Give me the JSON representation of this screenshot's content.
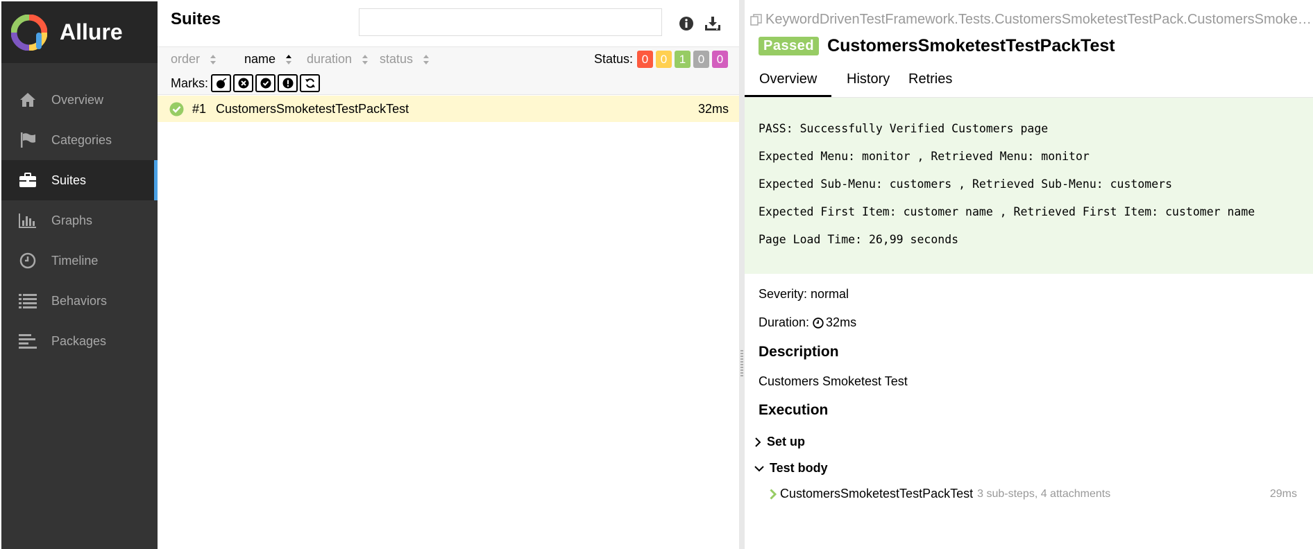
{
  "sidebar": {
    "brand": "Allure",
    "items": [
      {
        "label": "Overview",
        "icon": "home-icon"
      },
      {
        "label": "Categories",
        "icon": "flag-icon"
      },
      {
        "label": "Suites",
        "icon": "briefcase-icon",
        "active": true
      },
      {
        "label": "Graphs",
        "icon": "bar-chart-icon"
      },
      {
        "label": "Timeline",
        "icon": "clock-icon"
      },
      {
        "label": "Behaviors",
        "icon": "list-icon"
      },
      {
        "label": "Packages",
        "icon": "align-left-icon"
      }
    ]
  },
  "suites": {
    "title": "Suites",
    "search": {
      "value": "",
      "placeholder": ""
    },
    "sort": {
      "order": "order",
      "name": "name",
      "duration": "duration",
      "status": "status"
    },
    "status_label": "Status:",
    "status_counts": [
      {
        "value": "0",
        "color": "#fd5a3e"
      },
      {
        "value": "0",
        "color": "#ffd050"
      },
      {
        "value": "1",
        "color": "#97cc64"
      },
      {
        "value": "0",
        "color": "#aaaaaa"
      },
      {
        "value": "0",
        "color": "#d35ebe"
      }
    ],
    "marks_label": "Marks:",
    "rows": [
      {
        "num": "#1",
        "name": "CustomersSmoketestTestPackTest",
        "duration": "32ms"
      }
    ]
  },
  "detail": {
    "breadcrumb": "KeywordDrivenTestFramework.Tests.CustomersSmoketestTestPack.CustomersSmoketestTestPackTest",
    "status": "Passed",
    "title": "CustomersSmoketestTestPackTest",
    "tabs": [
      "Overview",
      "History",
      "Retries"
    ],
    "message": [
      "PASS: Successfully Verified Customers page",
      "Expected Menu: monitor , Retrieved Menu: monitor",
      "Expected Sub-Menu: customers , Retrieved Sub-Menu: customers",
      "Expected First Item: customer name , Retrieved First Item: customer name",
      "Page Load Time: 26,99 seconds"
    ],
    "severity": "Severity: normal",
    "duration_label": "Duration:",
    "duration_value": "32ms",
    "description_heading": "Description",
    "description": "Customers Smoketest Test",
    "execution_heading": "Execution",
    "setup_label": "Set up",
    "testbody_label": "Test body",
    "step": {
      "name": "CustomersSmoketestTestPackTest",
      "info": "3 sub-steps, 4 attachments",
      "duration": "29ms"
    }
  }
}
